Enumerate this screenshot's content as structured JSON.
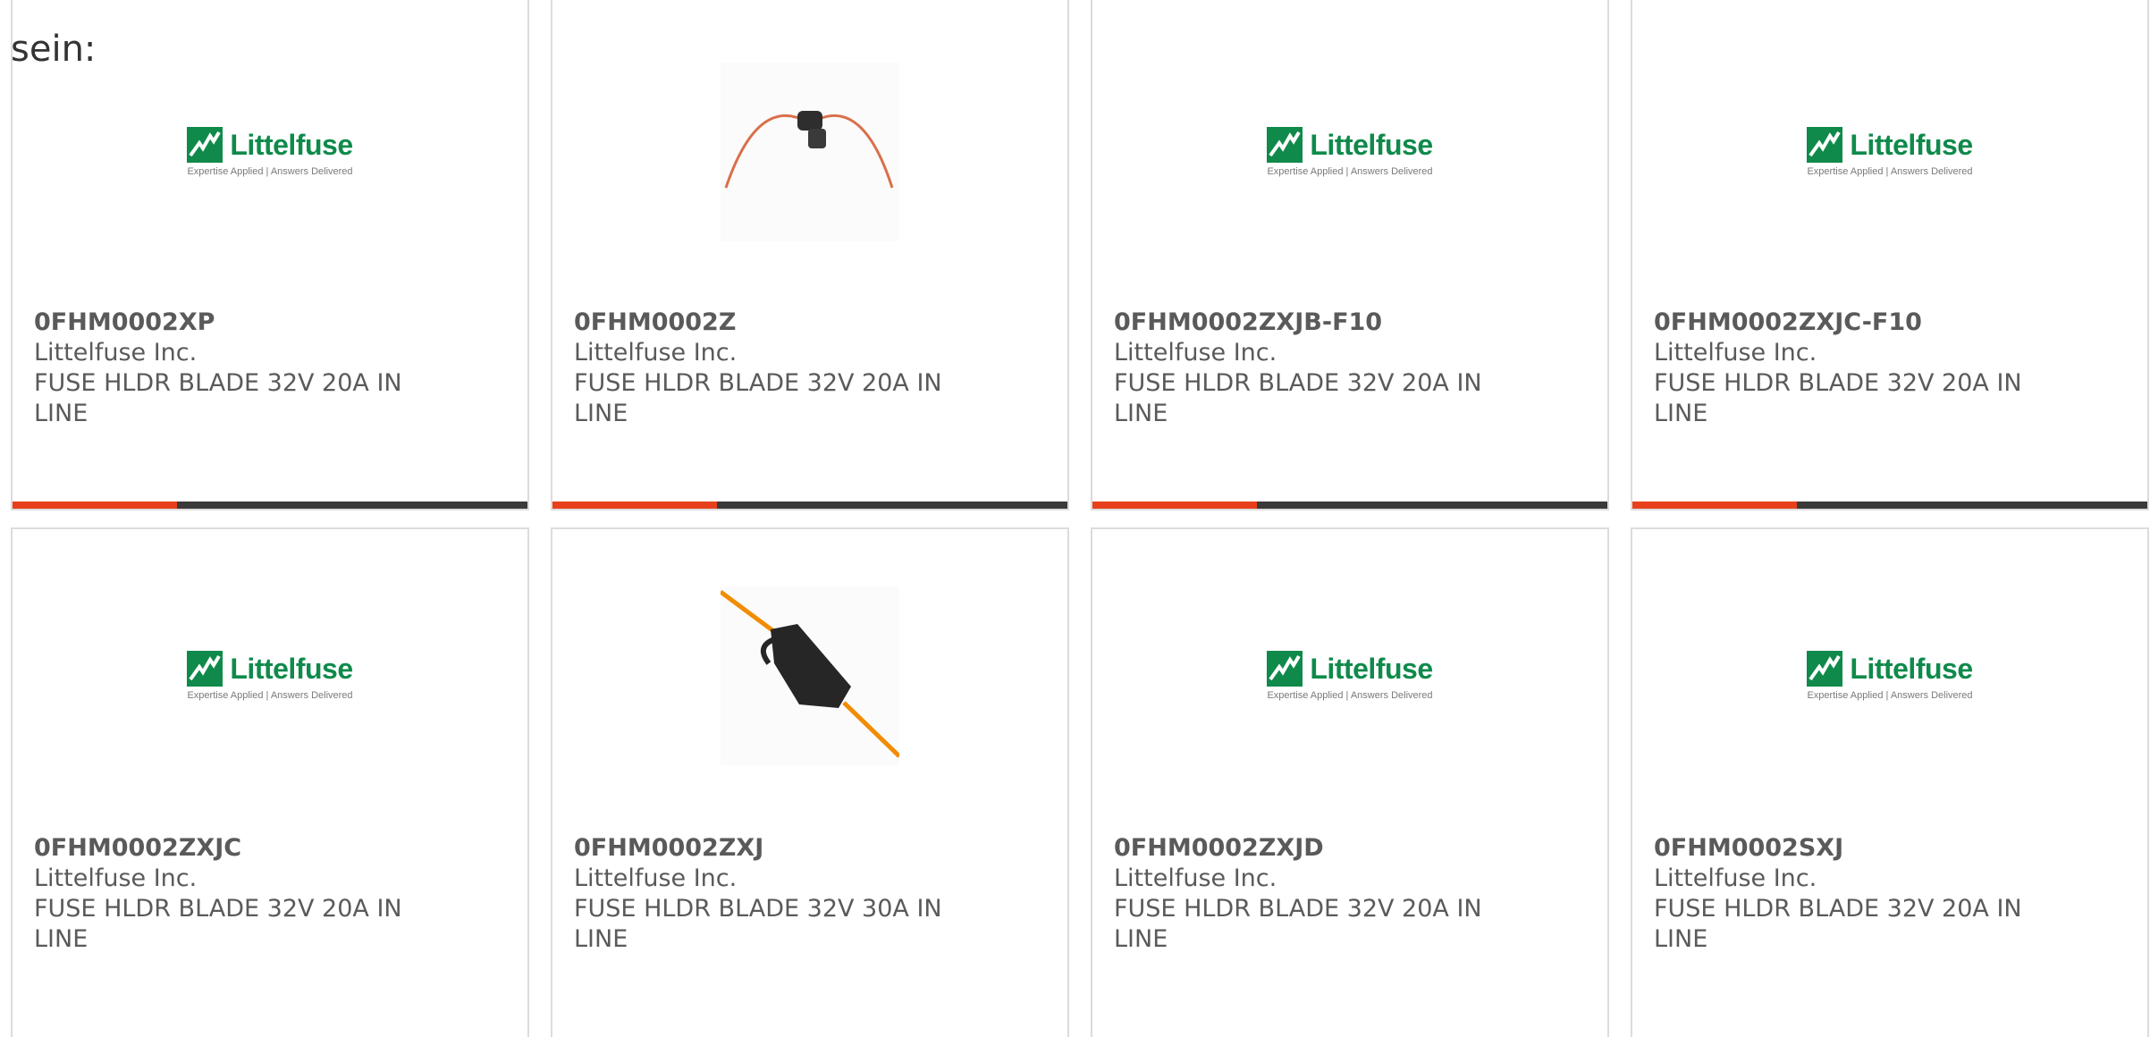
{
  "intro_text": "sein:",
  "colors": {
    "accent": "#e8401c",
    "bar_track": "#3a3a3a",
    "brand_green": "#0f8a4b"
  },
  "logo": {
    "name": "Littelfuse",
    "tagline": "Expertise Applied | Answers Delivered"
  },
  "products": [
    {
      "part_no": "0FHM0002XP",
      "manufacturer": "Littelfuse Inc.",
      "description": "FUSE HLDR BLADE 32V 20A IN LINE",
      "image": "littelfuse-logo",
      "progress": 0.32
    },
    {
      "part_no": "0FHM0002Z",
      "manufacturer": "Littelfuse Inc.",
      "description": "FUSE HLDR BLADE 32V 20A IN LINE",
      "image": "fuse-holder-thin-wire-photo",
      "progress": 0.32
    },
    {
      "part_no": "0FHM0002ZXJB-F10",
      "manufacturer": "Littelfuse Inc.",
      "description": "FUSE HLDR BLADE 32V 20A IN LINE",
      "image": "littelfuse-logo",
      "progress": 0.32
    },
    {
      "part_no": "0FHM0002ZXJC-F10",
      "manufacturer": "Littelfuse Inc.",
      "description": "FUSE HLDR BLADE 32V 20A IN LINE",
      "image": "littelfuse-logo",
      "progress": 0.32
    },
    {
      "part_no": "0FHM0002ZXJC",
      "manufacturer": "Littelfuse Inc.",
      "description": "FUSE HLDR BLADE 32V 20A IN LINE",
      "image": "littelfuse-logo"
    },
    {
      "part_no": "0FHM0002ZXJ",
      "manufacturer": "Littelfuse Inc.",
      "description": "FUSE HLDR BLADE 32V 30A IN LINE",
      "image": "fuse-holder-orange-wire-photo"
    },
    {
      "part_no": "0FHM0002ZXJD",
      "manufacturer": "Littelfuse Inc.",
      "description": "FUSE HLDR BLADE 32V 20A IN LINE",
      "image": "littelfuse-logo"
    },
    {
      "part_no": "0FHM0002SXJ",
      "manufacturer": "Littelfuse Inc.",
      "description": "FUSE HLDR BLADE 32V 20A IN LINE",
      "image": "littelfuse-logo"
    }
  ]
}
